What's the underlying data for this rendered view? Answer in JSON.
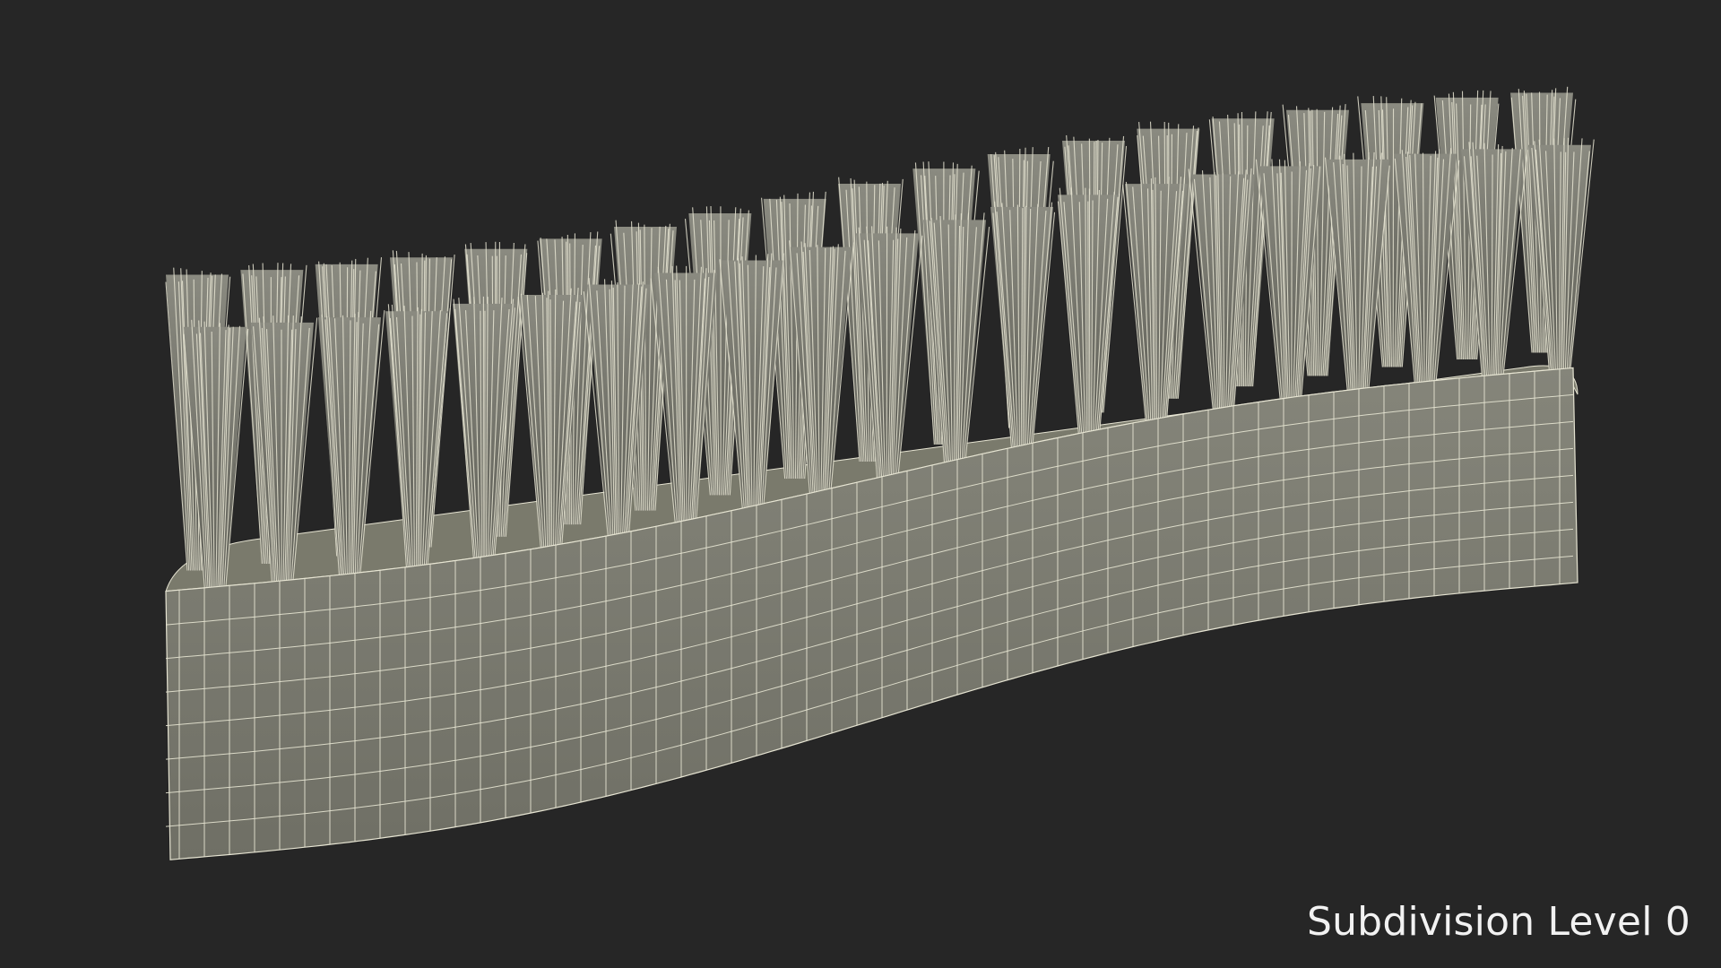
{
  "viewport": {
    "background": "#262626",
    "caption": "Subdivision Level 0"
  },
  "model": {
    "surface_color": "#7a7a6c",
    "wire_color": "#e6e4d2"
  }
}
